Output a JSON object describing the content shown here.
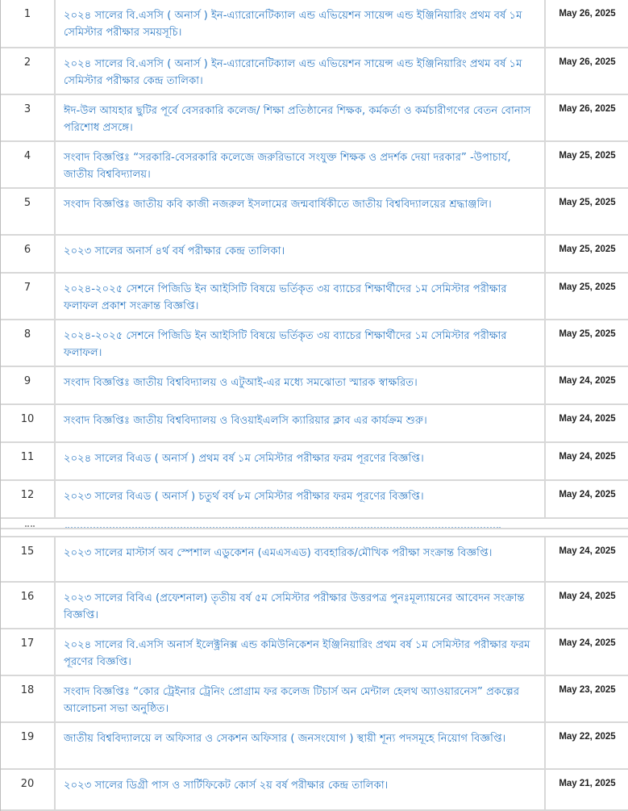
{
  "notices": [
    {
      "sl": "1",
      "title": "২০২৪ সালের বি.এসসি ( অনার্স ) ইন-এ্যারোনেটিক্যাল এন্ড এভিয়েশন সায়েন্স এন্ড ইঞ্জিনিয়ারিং প্রথম বর্ষ ১ম সেমিস্টার পরীক্ষার সময়সূচি।",
      "date": "May 26, 2025"
    },
    {
      "sl": "2",
      "title": "২০২৪ সালের বি.এসসি ( অনার্স ) ইন-এ্যারোনেটিক্যাল এন্ড এভিয়েশন সায়েন্স এন্ড ইঞ্জিনিয়ারিং প্রথম বর্ষ ১ম সেমিস্টার পরীক্ষার কেন্দ্র তালিকা।",
      "date": "May 26, 2025"
    },
    {
      "sl": "3",
      "title": "ঈদ-উল আযহার ছুটির পূর্বে বেসরকারি কলেজ/ শিক্ষা প্রতিষ্ঠানের শিক্ষক, কর্মকর্তা ও কর্মচারীগণের বেতন বোনাস পরিশোধ প্রসঙ্গে।",
      "date": "May 26, 2025"
    },
    {
      "sl": "4",
      "title": "সংবাদ বিজ্ঞপ্তিঃ “সরকারি-বেসরকারি কলেজে জরুরিভাবে সংযুক্ত শিক্ষক ও প্রদর্শক দেয়া দরকার” -উপাচার্য, জাতীয় বিশ্ববিদ্যালয়।",
      "date": "May 25, 2025"
    },
    {
      "sl": "5",
      "title": "সংবাদ বিজ্ঞপ্তিঃ জাতীয় কবি কাজী নজরুল ইসলামের জন্মবার্ষিকীতে জাতীয় বিশ্ববিদ্যালয়ের শ্রদ্ধাঞ্জলি।",
      "date": "May 25, 2025"
    },
    {
      "sl": "6",
      "title": "২০২৩ সালের অনার্স ৪র্থ বর্ষ পরীক্ষার কেন্দ্র তালিকা।",
      "date": "May 25, 2025"
    },
    {
      "sl": "7",
      "title": "২০২৪-২০২৫ সেশনে পিজিডি ইন আইসিটি বিষয়ে ভর্তিকৃত ৩য় ব্যাচের শিক্ষার্থীদের ১ম সেমিস্টার পরীক্ষার ফলাফল প্রকাশ সংক্রান্ত বিজ্ঞপ্তি।",
      "date": "May 25, 2025"
    },
    {
      "sl": "8",
      "title": "২০২৪-২০২৫ সেশনে পিজিডি ইন আইসিটি বিষয়ে ভর্তিকৃত ৩য় ব্যাচের শিক্ষার্থীদের ১ম সেমিস্টার পরীক্ষার ফলাফল।",
      "date": "May 25, 2025"
    },
    {
      "sl": "9",
      "title": "সংবাদ বিজ্ঞপ্তিঃ জাতীয় বিশ্ববিদ্যালয় ও এটুআই-এর মধ্যে সমঝোতা স্মারক স্বাক্ষরিত।",
      "date": "May 24, 2025"
    },
    {
      "sl": "10",
      "title": "সংবাদ বিজ্ঞপ্তিঃ জাতীয় বিশ্ববিদ্যালয় ও বিওয়াইএলসি ক্যারিয়ার ক্লাব এর কার্যক্রম শুরু।",
      "date": "May 24, 2025"
    },
    {
      "sl": "11",
      "title": "২০২৪ সালের বিএড ( অনার্স ) প্রথম বর্ষ ১ম সেমিস্টার পরীক্ষার ফরম পূরণের বিজ্ঞপ্তি।",
      "date": "May 24, 2025"
    },
    {
      "sl": "12",
      "title": "২০২৩ সালের বিএড ( অনার্স ) চতুর্থ বর্ষ ৮ম সেমিস্টার পরীক্ষার ফরম পূরণের বিজ্ঞপ্তি।",
      "date": "May 24, 2025"
    },
    {
      "sl": "15",
      "title": "২০২৩ সালের মাস্টার্স অব স্পেশাল এডুকেশন (এমএসএড) ব্যবহারিক/মৌখিক পরীক্ষা সংক্রান্ত বিজ্ঞপ্তি।",
      "date": "May 24, 2025"
    },
    {
      "sl": "16",
      "title": "২০২৩ সালের বিবিএ (প্রফেশনাল) তৃতীয় বর্ষ ৫ম সেমিস্টার পরীক্ষার উত্তরপত্র পুনঃমূল্যায়নের আবেদন সংক্রান্ত বিজ্ঞপ্তি।",
      "date": "May 24, 2025"
    },
    {
      "sl": "17",
      "title": "২০২৪ সালের বি.এসসি অনার্স ইলেক্ট্রনিক্স এন্ড কমিউনিকেশন ইঞ্জিনিয়ারিং প্রথম বর্ষ ১ম সেমিস্টার পরীক্ষার ফরম পূরণের বিজ্ঞপ্তি।",
      "date": "May 24, 2025"
    },
    {
      "sl": "18",
      "title": "সংবাদ বিজ্ঞপ্তিঃ “কোর ট্রেইনার ট্রেনিং প্রোগ্রাম ফর কলেজ টিচার্স অন মেন্টাল হেলথ অ্যাওয়ারনেস” প্রকল্পের আলোচনা সভা অনুষ্ঠিত।",
      "date": "May 23, 2025"
    },
    {
      "sl": "19",
      "title": "জাতীয় বিশ্ববিদ্যালয়ে ল অফিসার ও সেকশন অফিসার ( জনসংযোগ ) স্থায়ী শূন্য পদসমূহে নিয়োগ বিজ্ঞপ্তি।",
      "date": "May 22, 2025"
    },
    {
      "sl": "20",
      "title": "২০২৩ সালের ডিগ্রী পাস ও সার্টিফিকেট কোর্স ২য় বর্ষ পরীক্ষার কেন্দ্র তালিকা।",
      "date": "May 21, 2025"
    }
  ]
}
